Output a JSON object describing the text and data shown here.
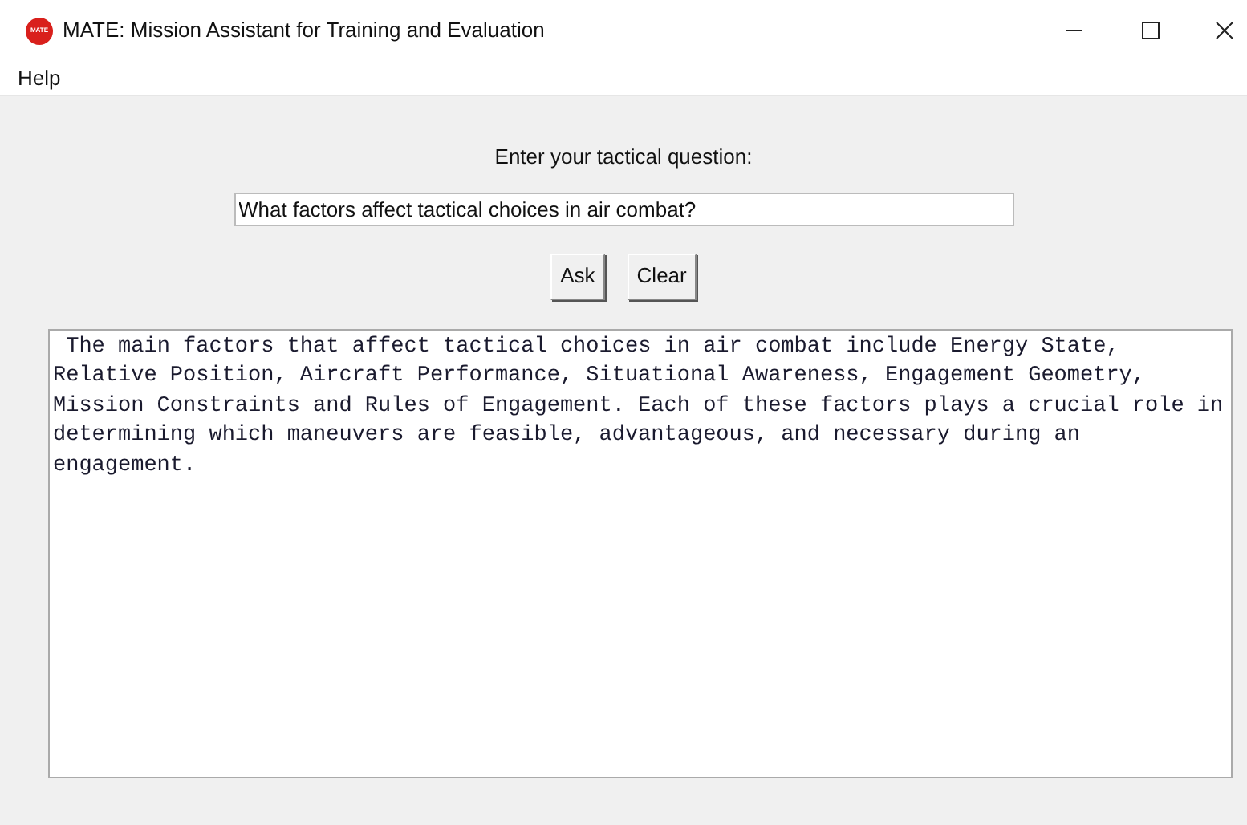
{
  "window": {
    "title": "MATE: Mission Assistant for Training and Evaluation",
    "logo": "MATE"
  },
  "menu": [
    "Help"
  ],
  "prompt_label": "Enter your tactical question:",
  "question": {
    "value": "What factors affect tactical choices in air combat?"
  },
  "buttons": [
    "Ask",
    "Clear"
  ],
  "answer": " The main factors that affect tactical choices in air combat include Energy State, Relative Position, Aircraft Performance, Situational Awareness, Engagement Geometry, Mission Constraints and Rules of Engagement. Each of these factors plays a crucial role in determining which maneuvers are feasible, advantageous, and necessary during an engagement."
}
